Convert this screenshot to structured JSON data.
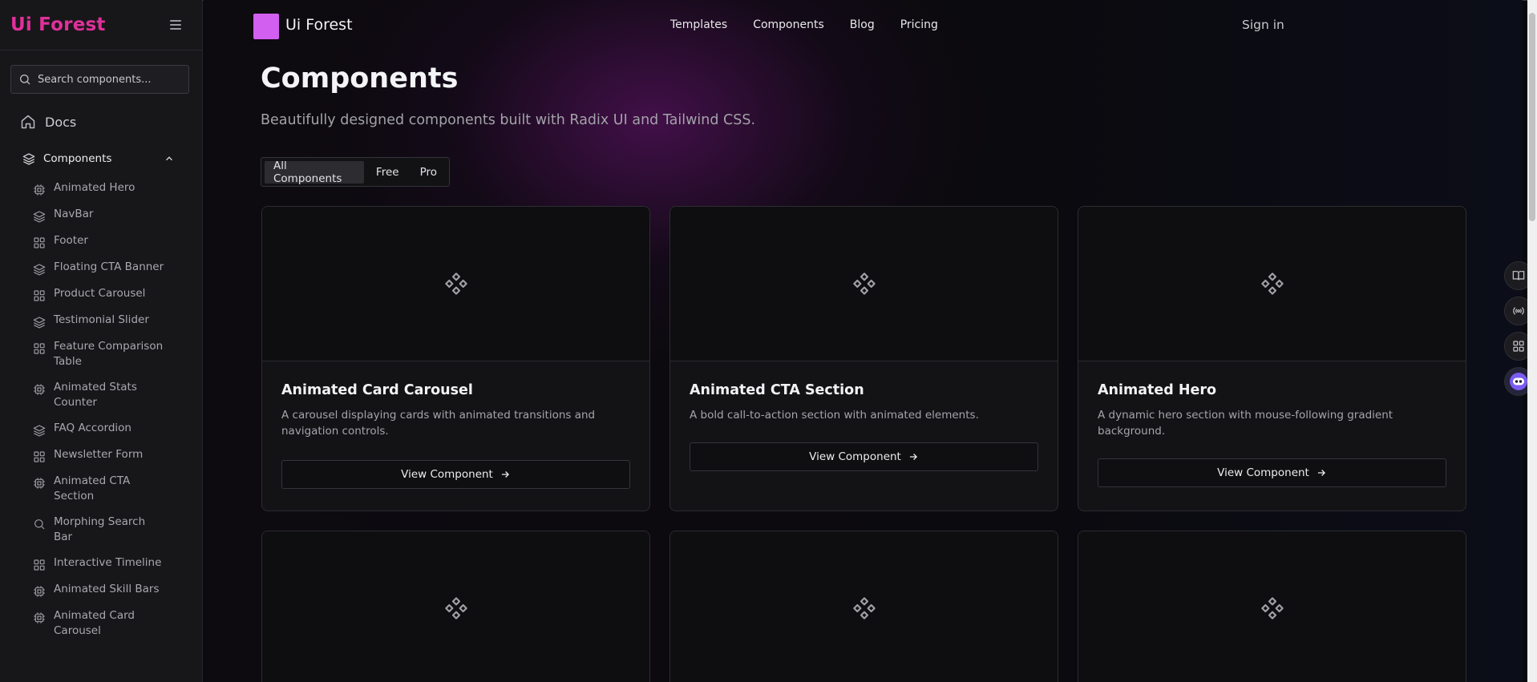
{
  "sidebar": {
    "brand": "Ui Forest",
    "search_placeholder": "Search components...",
    "docs_label": "Docs",
    "components_label": "Components",
    "items": [
      {
        "label": "Animated Hero",
        "icon": "cpu-icon"
      },
      {
        "label": "NavBar",
        "icon": "layers-icon"
      },
      {
        "label": "Footer",
        "icon": "grid-icon"
      },
      {
        "label": "Floating CTA Banner",
        "icon": "layers-icon"
      },
      {
        "label": "Product Carousel",
        "icon": "grid-icon"
      },
      {
        "label": "Testimonial Slider",
        "icon": "layers-icon"
      },
      {
        "label": "Feature Comparison Table",
        "icon": "grid-icon"
      },
      {
        "label": "Animated Stats Counter",
        "icon": "cpu-icon"
      },
      {
        "label": "FAQ Accordion",
        "icon": "layers-icon"
      },
      {
        "label": "Newsletter Form",
        "icon": "grid-icon"
      },
      {
        "label": "Animated CTA Section",
        "icon": "cpu-icon"
      },
      {
        "label": "Morphing Search Bar",
        "icon": "search-icon"
      },
      {
        "label": "Interactive Timeline",
        "icon": "grid-icon"
      },
      {
        "label": "Animated Skill Bars",
        "icon": "cpu-icon"
      },
      {
        "label": "Animated Card Carousel",
        "icon": "cpu-icon"
      }
    ]
  },
  "header": {
    "logo_text": "Ui Forest",
    "nav": [
      "Templates",
      "Components",
      "Blog",
      "Pricing"
    ],
    "signin": "Sign in"
  },
  "main": {
    "title": "Components",
    "subtitle": "Beautifully designed components built with Radix UI and Tailwind CSS.",
    "tabs": [
      "All Components",
      "Free",
      "Pro"
    ],
    "active_tab": "All Components",
    "view_label": "View Component",
    "cards": [
      {
        "title": "Animated Card Carousel",
        "description": "A carousel displaying cards with animated transitions and navigation controls."
      },
      {
        "title": "Animated CTA Section",
        "description": "A bold call-to-action section with animated elements."
      },
      {
        "title": "Animated Hero",
        "description": "A dynamic hero section with mouse-following gradient background."
      }
    ]
  },
  "colors": {
    "brand": "#e0309a",
    "logo_square": "#d35ff0",
    "background": "#0a0a0c",
    "sidebar_bg": "#17171a"
  }
}
